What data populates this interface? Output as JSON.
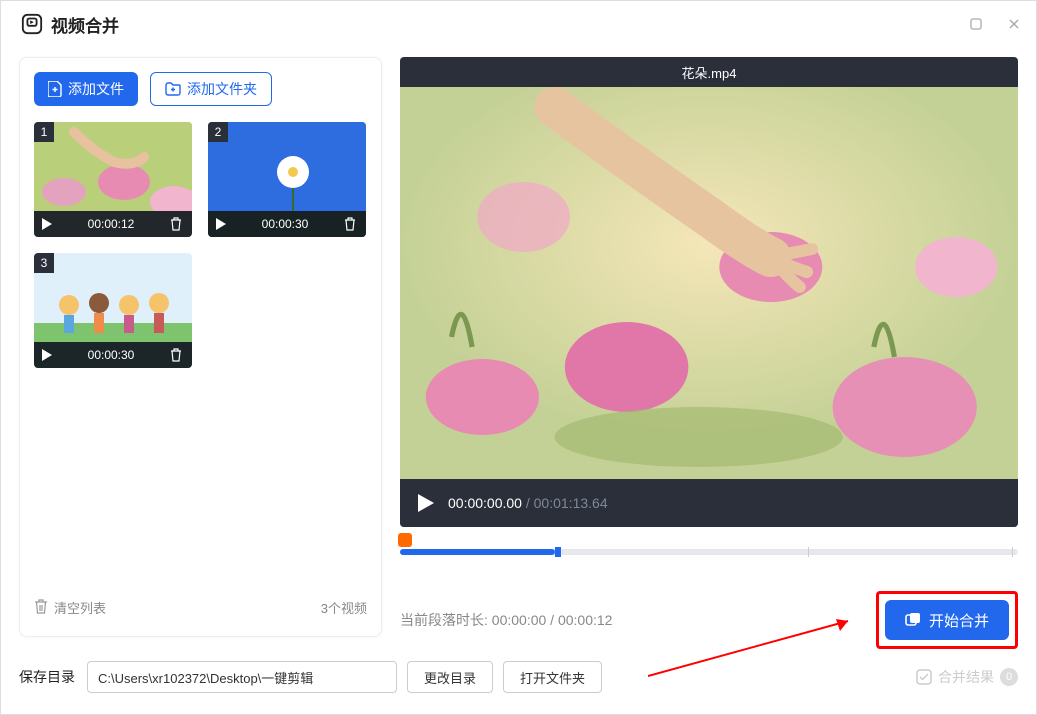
{
  "title": "视频合并",
  "buttons": {
    "add_file": "添加文件",
    "add_folder": "添加文件夹",
    "clear_list": "清空列表",
    "start_merge": "开始合并",
    "change_dir": "更改目录",
    "open_folder": "打开文件夹",
    "merge_result": "合并结果"
  },
  "clips": [
    {
      "index": "1",
      "duration": "00:00:12"
    },
    {
      "index": "2",
      "duration": "00:00:30"
    },
    {
      "index": "3",
      "duration": "00:00:30"
    }
  ],
  "clip_count": "3个视频",
  "preview": {
    "title": "花朵.mp4",
    "current_time": "00:00:00.00",
    "total_time": "00:01:13.64",
    "sep": " / "
  },
  "segment": {
    "prefix": "当前段落时长: ",
    "current": "00:00:00",
    "sep": " / ",
    "total": "00:00:12"
  },
  "save": {
    "label": "保存目录",
    "path": "C:\\Users\\xr102372\\Desktop\\一键剪辑"
  },
  "result_count": "0",
  "colors": {
    "accent": "#2168ed",
    "annotation": "#ff0000"
  }
}
